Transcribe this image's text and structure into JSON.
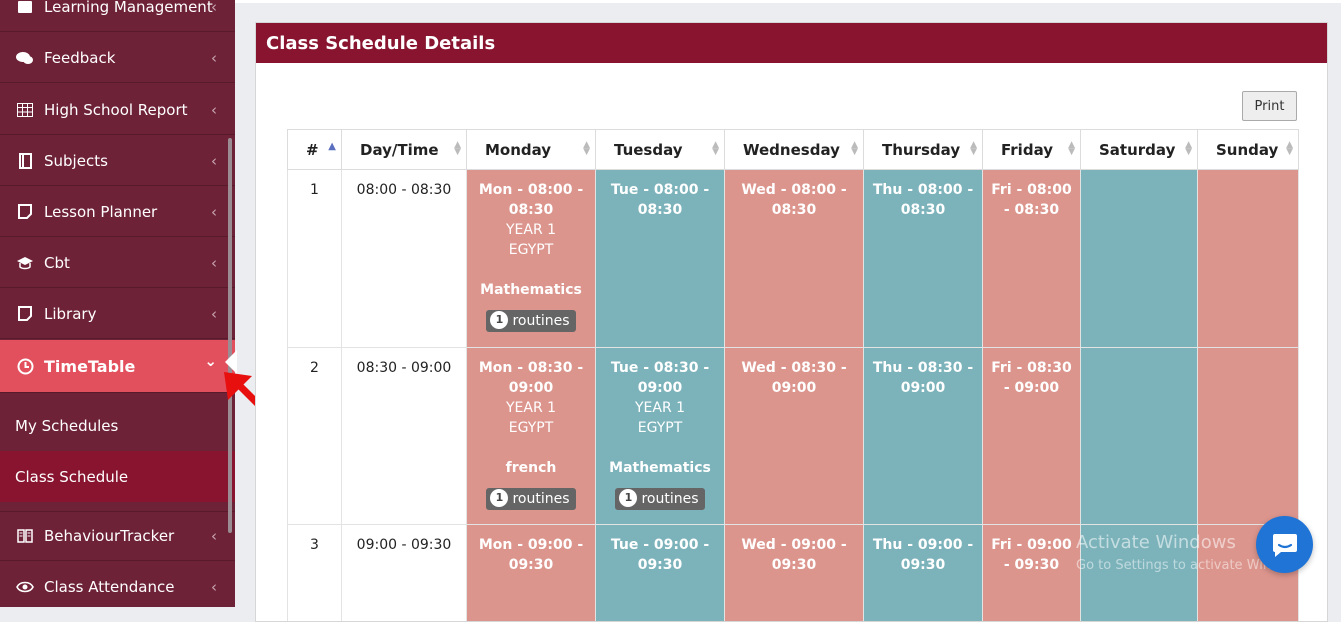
{
  "sidebar": {
    "items": [
      {
        "label": "Learning Management",
        "icon": "book-icon"
      },
      {
        "label": "Feedback",
        "icon": "comments-icon"
      },
      {
        "label": "High School Report",
        "icon": "table-icon"
      },
      {
        "label": "Subjects",
        "icon": "book-icon"
      },
      {
        "label": "Lesson Planner",
        "icon": "note-icon"
      },
      {
        "label": "Cbt",
        "icon": "graduation-cap-icon"
      },
      {
        "label": "Library",
        "icon": "note-icon"
      },
      {
        "label": "TimeTable",
        "icon": "clock-icon"
      },
      {
        "label": "BehaviourTracker",
        "icon": "book-open-icon"
      },
      {
        "label": "Class Attendance",
        "icon": "eye-icon"
      }
    ],
    "submenu": [
      "My Schedules",
      "Class Schedule"
    ],
    "chevron_left": "‹",
    "chevron_down": "⌄"
  },
  "panel": {
    "title": "Class Schedule Details",
    "print_label": "Print"
  },
  "table": {
    "headers": [
      "#",
      "Day/Time",
      "Monday",
      "Tuesday",
      "Wednesday",
      "Thursday",
      "Friday",
      "Saturday",
      "Sunday"
    ],
    "rows": [
      {
        "num": "1",
        "time": "08:00 - 08:30",
        "slots": [
          {
            "time": "Mon - 08:00 - 08:30",
            "lines": [
              "YEAR 1",
              "EGYPT"
            ],
            "subject": "Mathematics",
            "badge_count": "1",
            "badge_label": "routines"
          },
          {
            "time": "Tue - 08:00 - 08:30"
          },
          {
            "time": "Wed - 08:00 - 08:30"
          },
          {
            "time": "Thu - 08:00 - 08:30"
          },
          {
            "time": "Fri - 08:00 - 08:30"
          },
          {
            "time": ""
          },
          {
            "time": ""
          }
        ]
      },
      {
        "num": "2",
        "time": "08:30 - 09:00",
        "slots": [
          {
            "time": "Mon - 08:30 - 09:00",
            "lines": [
              "YEAR 1",
              "EGYPT"
            ],
            "subject": "french",
            "badge_count": "1",
            "badge_label": "routines"
          },
          {
            "time": "Tue - 08:30 - 09:00",
            "lines": [
              "YEAR 1",
              "EGYPT"
            ],
            "subject": "Mathematics",
            "badge_count": "1",
            "badge_label": "routines"
          },
          {
            "time": "Wed - 08:30 - 09:00"
          },
          {
            "time": "Thu - 08:30 - 09:00"
          },
          {
            "time": "Fri - 08:30 - 09:00"
          },
          {
            "time": ""
          },
          {
            "time": ""
          }
        ]
      },
      {
        "num": "3",
        "time": "09:00 - 09:30",
        "slots": [
          {
            "time": "Mon - 09:00 - 09:30"
          },
          {
            "time": "Tue - 09:00 - 09:30"
          },
          {
            "time": "Wed - 09:00 - 09:30"
          },
          {
            "time": "Thu - 09:00 - 09:30"
          },
          {
            "time": "Fri - 09:00 - 09:30"
          },
          {
            "time": ""
          },
          {
            "time": ""
          }
        ]
      }
    ]
  },
  "watermark": {
    "line1": "Activate Windows",
    "line2": "Go to Settings to activate Windows."
  },
  "colors": {
    "sidebar": "#6e2238",
    "active": "#e2505d",
    "header": "#88142f",
    "pink": "#dc958d",
    "teal": "#7cb3bb",
    "chat": "#1f74d6"
  }
}
